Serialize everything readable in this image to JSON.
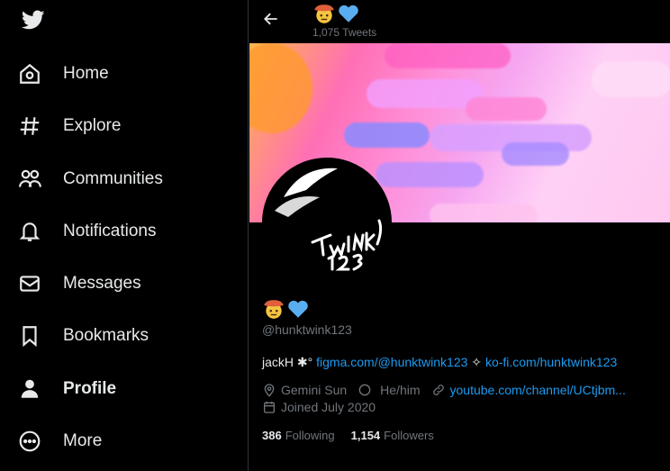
{
  "sidebar": {
    "items": [
      {
        "label": "Home",
        "icon": "home-icon"
      },
      {
        "label": "Explore",
        "icon": "hashtag-icon"
      },
      {
        "label": "Communities",
        "icon": "communities-icon"
      },
      {
        "label": "Notifications",
        "icon": "bell-icon"
      },
      {
        "label": "Messages",
        "icon": "envelope-icon"
      },
      {
        "label": "Bookmarks",
        "icon": "bookmark-icon"
      },
      {
        "label": "Profile",
        "icon": "person-icon"
      },
      {
        "label": "More",
        "icon": "more-circle-icon"
      }
    ]
  },
  "header": {
    "name_emoji": "🤠💙",
    "tweet_count": "1,075 Tweets"
  },
  "profile": {
    "name_emoji": "🤠💙",
    "handle": "@hunktwink123",
    "bio_prefix": "jackH ✱° ",
    "bio_link1": "figma.com/@hunktwink123",
    "bio_sep": " ✧ ",
    "bio_link2": "ko-fi.com/hunktwink123",
    "location": "Gemini Sun",
    "pronouns": "He/him",
    "website": "youtube.com/channel/UCtjbm...",
    "joined": "Joined July 2020",
    "following_count": "386",
    "following_label": "Following",
    "followers_count": "1,154",
    "followers_label": "Followers",
    "avatar_text": "twink 123"
  },
  "colors": {
    "background": "#000000",
    "text": "#e7e9ea",
    "muted": "#71767b",
    "link": "#1d9bf0"
  }
}
